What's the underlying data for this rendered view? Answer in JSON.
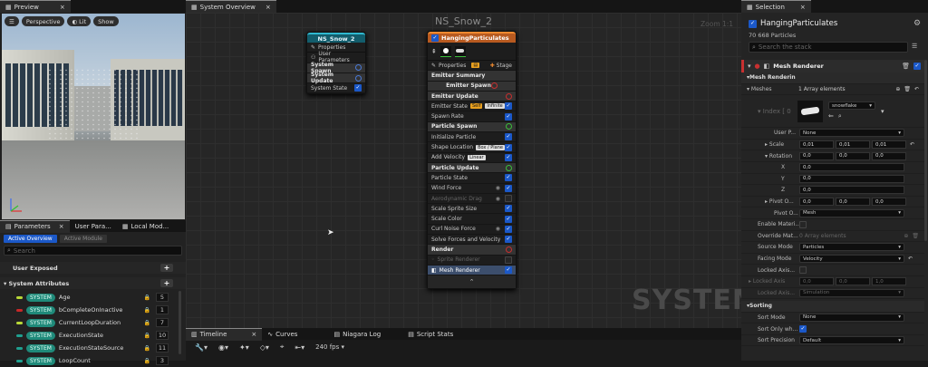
{
  "preview": {
    "tab": "Preview",
    "perspective": "Perspective",
    "lit": "Lit",
    "show": "Show"
  },
  "params": {
    "tabs": [
      "Parameters",
      "User Para...",
      "Local Mod..."
    ],
    "subtabs": [
      "Active Overview",
      "Active Module"
    ],
    "search_placeholder": "Search",
    "user_exposed": "User Exposed",
    "system_attributes": "System Attributes",
    "tag": "SYSTEM",
    "rows": [
      {
        "name": "Age",
        "val": "5",
        "color": "#b8d838"
      },
      {
        "name": "bCompleteOnInactive",
        "val": "1",
        "color": "#c82828"
      },
      {
        "name": "CurrentLoopDuration",
        "val": "7",
        "color": "#b8d838"
      },
      {
        "name": "ExecutionState",
        "val": "10",
        "color": "#1fa090"
      },
      {
        "name": "ExecutionStateSource",
        "val": "11",
        "color": "#1fa090"
      },
      {
        "name": "LoopCount",
        "val": "3",
        "color": "#1fa090"
      }
    ]
  },
  "system_overview": {
    "tab": "System Overview",
    "title": "NS_Snow_2",
    "zoom": "Zoom 1:1",
    "watermark": "SYSTEM",
    "system_node": {
      "title": "NS_Snow_2",
      "rows": [
        "Properties",
        "User Parameters",
        "System Spawn",
        "System Update",
        "System State"
      ]
    },
    "emitter_node": {
      "title": "HangingParticulates",
      "properties": "Properties",
      "stage": "Stage",
      "summary": "Emitter Summary",
      "rows": [
        {
          "t": "Emitter Spawn",
          "kind": "head"
        },
        {
          "t": "Emitter Update",
          "kind": "sec"
        },
        {
          "t": "Emitter State",
          "kind": "row",
          "tag": "Self",
          "tag2": "Infinite"
        },
        {
          "t": "Spawn Rate",
          "kind": "row"
        },
        {
          "t": "Particle Spawn",
          "kind": "sec"
        },
        {
          "t": "Initialize Particle",
          "kind": "row"
        },
        {
          "t": "Shape Location",
          "kind": "row",
          "tag": "Box / Plane"
        },
        {
          "t": "Add Velocity",
          "kind": "row",
          "tag": "Linear"
        },
        {
          "t": "Particle Update",
          "kind": "sec"
        },
        {
          "t": "Particle State",
          "kind": "row"
        },
        {
          "t": "Wind Force",
          "kind": "row",
          "eye": true
        },
        {
          "t": "Aerodynamic Drag",
          "kind": "row",
          "eye": true,
          "dim": true
        },
        {
          "t": "Scale Sprite Size",
          "kind": "row"
        },
        {
          "t": "Scale Color",
          "kind": "row"
        },
        {
          "t": "Curl Noise Force",
          "kind": "row",
          "eye": true
        },
        {
          "t": "Solve Forces and Velocity",
          "kind": "row"
        },
        {
          "t": "Render",
          "kind": "sec"
        },
        {
          "t": "Sprite Renderer",
          "kind": "row",
          "dim": true
        },
        {
          "t": "Mesh Renderer",
          "kind": "sel"
        }
      ]
    }
  },
  "bottom": {
    "tabs": [
      "Timeline",
      "Curves",
      "Niagara Log",
      "Script Stats"
    ],
    "fps": "240 fps"
  },
  "selection": {
    "tab": "Selection",
    "emitter": "HangingParticulates",
    "particles": "70 668 Particles",
    "search_placeholder": "Search the stack",
    "mesh_renderer": "Mesh Renderer",
    "mesh_rendering": "Mesh Renderin",
    "meshes": "Meshes",
    "meshes_val": "1 Array elements",
    "index": "Index [ 0 ]",
    "mesh_name": "snowflake",
    "user_p": "User P...",
    "user_p_val": "None",
    "scale": "Scale",
    "scale_vals": [
      "0,01",
      "0,01",
      "0,01"
    ],
    "rotation": "Rotation",
    "rotation_vals": [
      "0,0",
      "0,0",
      "0,0"
    ],
    "x": "X",
    "y": "Y",
    "z": "Z",
    "xyz_vals": [
      "0,0",
      "0,0",
      "0,0"
    ],
    "pivot": "Pivot O...",
    "pivot_vals": [
      "0,0",
      "0,0",
      "0,0"
    ],
    "pivot2": "Pivot O...",
    "pivot2_val": "Mesh",
    "enable_mat": "Enable Materi...",
    "override_mat": "Override Mat...",
    "override_val": "0 Array elements",
    "source": "Source Mode",
    "source_val": "Particles",
    "facing": "Facing Mode",
    "facing_val": "Velocity",
    "locked1": "Locked Axis...",
    "locked2": "Locked Axis",
    "locked2_vals": [
      "0,0",
      "0,0",
      "1,0"
    ],
    "locked3": "Locked Axis...",
    "locked3_val": "Simulation",
    "sorting": "Sorting",
    "sort_mode": "Sort Mode",
    "sort_mode_val": "None",
    "sort_only": "Sort Only wh...",
    "sort_prec": "Sort Precision",
    "sort_prec_val": "Default"
  }
}
